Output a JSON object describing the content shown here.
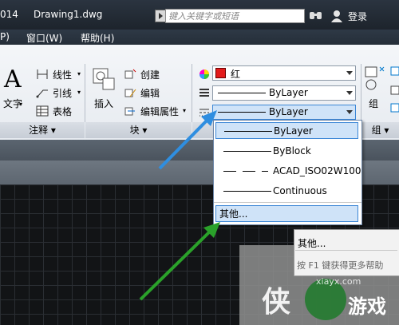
{
  "titlebar": {
    "version": "014",
    "document": "Drawing1.dwg",
    "search_placeholder": "键入关键字或短语",
    "login": "登录"
  },
  "menubar": {
    "items": [
      "P)",
      "窗口(W)",
      "帮助(H)"
    ]
  },
  "ribbon": {
    "text_label": "文字",
    "annotation_items": [
      "线性",
      "引线",
      "表格"
    ],
    "annotation_panel": "注释",
    "insert_label": "插入",
    "block_items": [
      "创建",
      "编辑",
      "编辑属性"
    ],
    "block_panel": "块",
    "color_value": "红",
    "linetype_value": "ByLayer",
    "lineweight_value": "ByLayer",
    "group_label": "组",
    "group_panel": "组"
  },
  "linetype_dropdown": {
    "items": [
      "ByLayer",
      "ByBlock",
      "ACAD_ISO02W100",
      "Continuous"
    ],
    "other": "其他..."
  },
  "tooltip": {
    "title": "其他...",
    "help": "按 F1 键获得更多帮助"
  },
  "colors": {
    "selection_fill": "#cfe3f8",
    "selection_border": "#3b86d6",
    "blue_arrow": "#2f8ee0",
    "green_arrow": "#2aa12a",
    "red_swatch": "#e31b1b"
  },
  "watermark": {
    "text": "游戏",
    "sub": "xiayx.com"
  }
}
